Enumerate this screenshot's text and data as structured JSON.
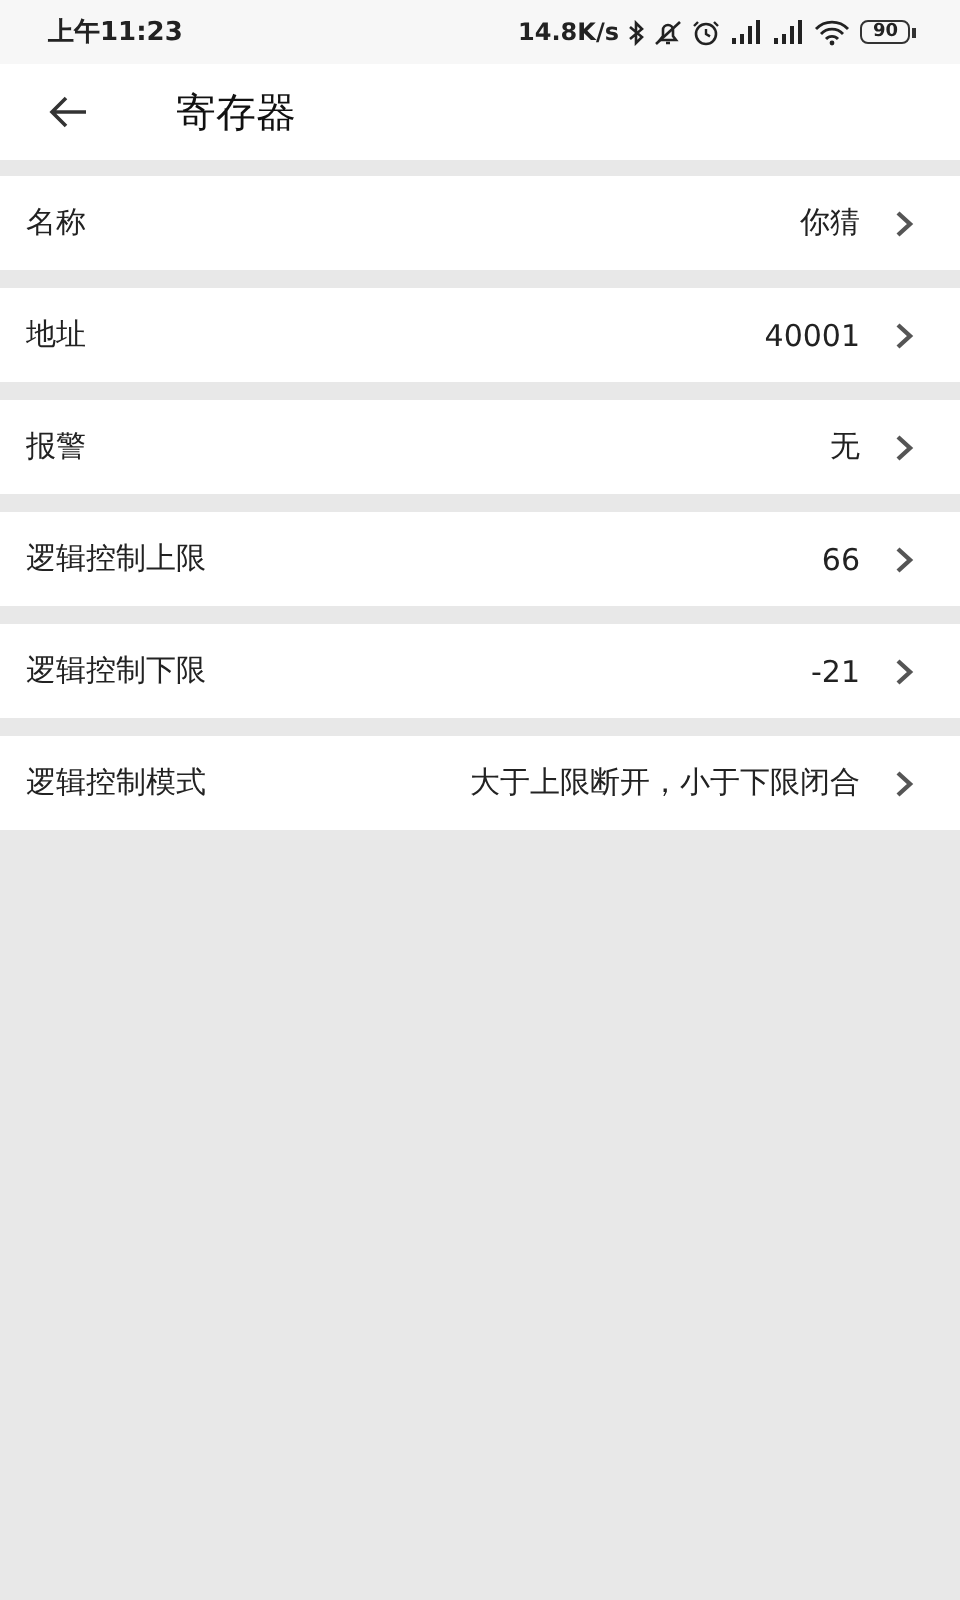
{
  "status_bar": {
    "time": "上午11:23",
    "speed": "14.8K/s",
    "battery": "90"
  },
  "app_bar": {
    "title": "寄存器"
  },
  "rows": [
    {
      "label": "名称",
      "value": "你猜"
    },
    {
      "label": "地址",
      "value": "40001"
    },
    {
      "label": "报警",
      "value": "无"
    },
    {
      "label": "逻辑控制上限",
      "value": "66"
    },
    {
      "label": "逻辑控制下限",
      "value": "-21"
    },
    {
      "label": "逻辑控制模式",
      "value": "大于上限断开，小于下限闭合"
    }
  ]
}
